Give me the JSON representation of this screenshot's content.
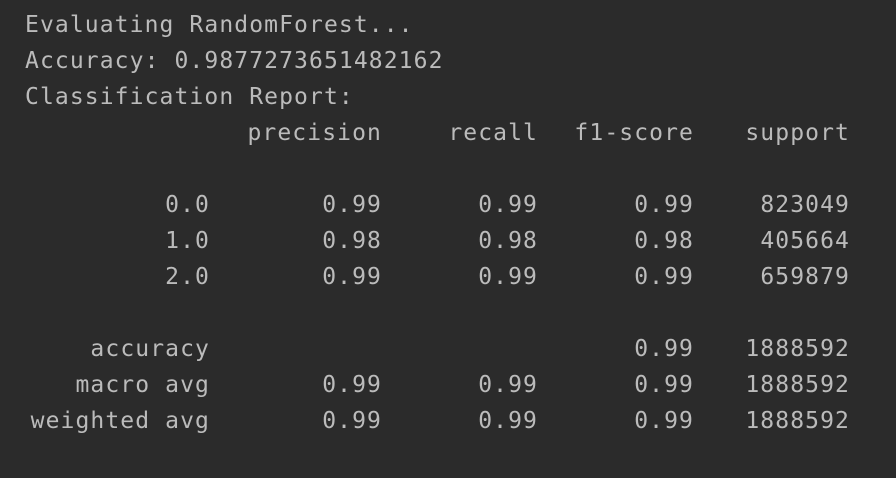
{
  "console": {
    "lines": [
      "Evaluating RandomForest...",
      "Accuracy: 0.9877273651482162",
      "Classification Report:"
    ],
    "report": {
      "headers": [
        "precision",
        "recall",
        "f1-score",
        "support"
      ],
      "class_rows": [
        {
          "label": "0.0",
          "precision": "0.99",
          "recall": "0.99",
          "f1": "0.99",
          "support": "823049"
        },
        {
          "label": "1.0",
          "precision": "0.98",
          "recall": "0.98",
          "f1": "0.98",
          "support": "405664"
        },
        {
          "label": "2.0",
          "precision": "0.99",
          "recall": "0.99",
          "f1": "0.99",
          "support": "659879"
        }
      ],
      "summary_rows": [
        {
          "label": "accuracy",
          "precision": "",
          "recall": "",
          "f1": "0.99",
          "support": "1888592"
        },
        {
          "label": "macro avg",
          "precision": "0.99",
          "recall": "0.99",
          "f1": "0.99",
          "support": "1888592"
        },
        {
          "label": "weighted avg",
          "precision": "0.99",
          "recall": "0.99",
          "f1": "0.99",
          "support": "1888592"
        }
      ]
    }
  },
  "colors": {
    "background": "#2b2b2b",
    "text": "#bbbbbb"
  }
}
